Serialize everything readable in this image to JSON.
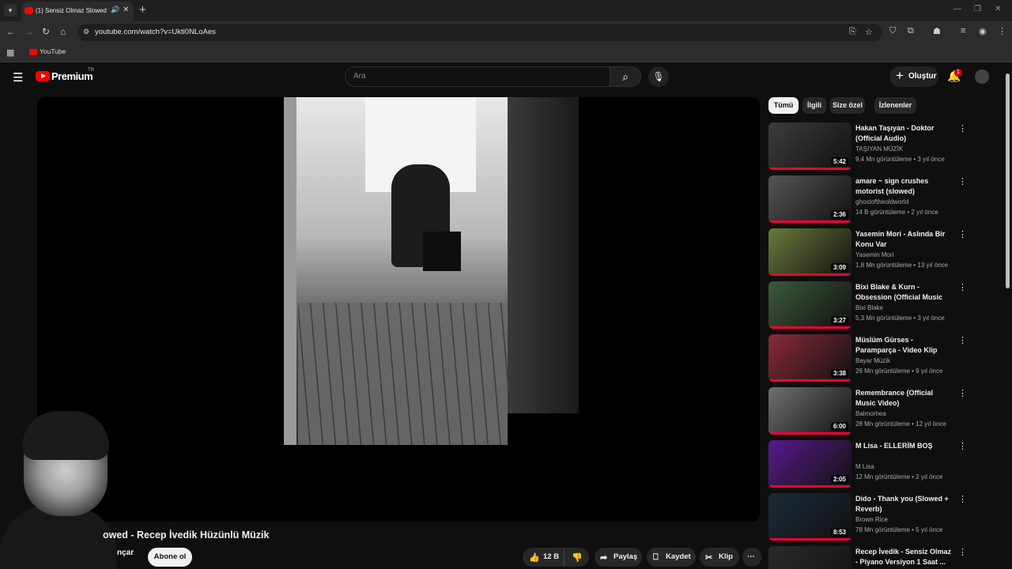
{
  "browser": {
    "tab_title": "(1) Sensiz Olmaz Slowed - R",
    "url": "youtube.com/watch?v=Ukti0NLoAes",
    "bookmark_label": "YouTube"
  },
  "masthead": {
    "logo_text": "Premium",
    "logo_region": "TR",
    "search_placeholder": "Ara",
    "create_label": "Oluştur",
    "notification_count": "1"
  },
  "video": {
    "title": "owed - Recep İvedik Hüzünlü Müzik",
    "channel": "nçar",
    "subscribe_label": "Abone ol",
    "like_count": "12 B",
    "share_label": "Paylaş",
    "save_label": "Kaydet",
    "clip_label": "Klip"
  },
  "chips": [
    "Tümü",
    "İlgili",
    "Size özel",
    "İzlenenler"
  ],
  "recommendations": [
    {
      "title": "Hakan Taşıyan - Doktor (Official Audio)",
      "channel": "TAŞIYAN MÜZİK",
      "meta": "9,4 Mn görüntüleme • 3 yıl önce",
      "duration": "5:42",
      "thumb_color": "#3c3c3c"
    },
    {
      "title": "amare ~ sign crushes motorist (slowed)",
      "channel": "ghostoftheoldworld",
      "meta": "14 B görüntüleme • 2 yıl önce",
      "duration": "2:36",
      "thumb_color": "#555555"
    },
    {
      "title": "Yasemin Mori - Aslında Bir Konu Var",
      "channel": "Yasemin Mori",
      "meta": "1,8 Mn görüntüleme • 13 yıl önce",
      "duration": "3:09",
      "thumb_color": "#6a7a3a"
    },
    {
      "title": "Bixi Blake & Kurn - Obsession (Official Music Video)",
      "channel": "Bixi Blake",
      "meta": "5,3 Mn görüntüleme • 3 yıl önce",
      "duration": "3:27",
      "thumb_color": "#3b5a3b"
    },
    {
      "title": "Müslüm Gürses - Paramparça - Video Klip",
      "channel": "Bayar Müzik",
      "meta": "26 Mn görüntüleme • 9 yıl önce",
      "duration": "3:38",
      "thumb_color": "#8a2a3a"
    },
    {
      "title": "Remembrance (Official Music Video)",
      "channel": "Balmorhea",
      "meta": "28 Mn görüntüleme • 12 yıl önce",
      "duration": "6:00",
      "thumb_color": "#707070"
    },
    {
      "title": "M Lisa - ELLERİM BOŞ",
      "channel": "M Lisa",
      "meta": "12 Mn görüntüleme • 2 yıl önce",
      "duration": "2:05",
      "thumb_color": "#5a1a8a"
    },
    {
      "title": "Dido - Thank you (Slowed + Reverb)",
      "channel": "Brown Rice",
      "meta": "78 Mn görüntüleme • 5 yıl önce",
      "duration": "8:53",
      "thumb_color": "#1a2a3a"
    },
    {
      "title": "Recep İvedik - Sensiz Olmaz - Piyano Versiyon 1 Saat ...",
      "channel": "",
      "meta": "",
      "duration": "",
      "thumb_color": "#2a2a2a"
    }
  ]
}
